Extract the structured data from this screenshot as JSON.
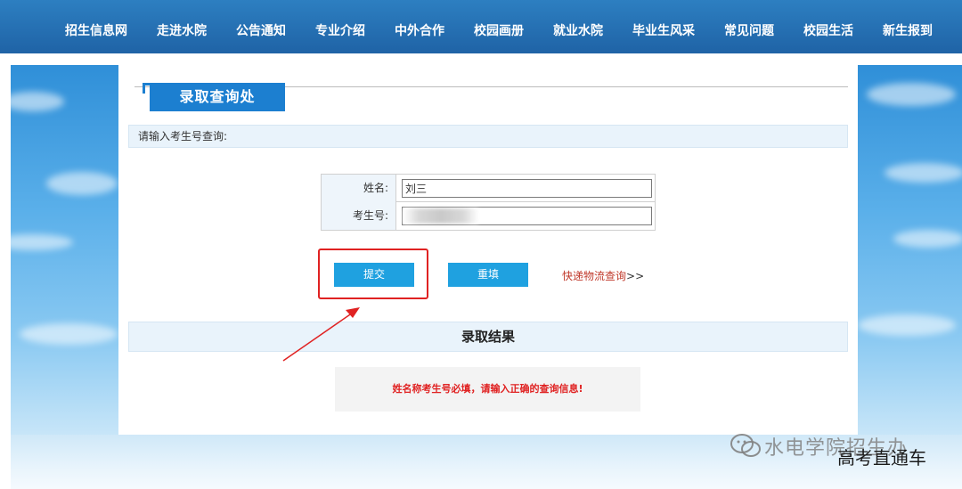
{
  "nav": {
    "items": [
      {
        "label": "招生信息网"
      },
      {
        "label": "走进水院"
      },
      {
        "label": "公告通知"
      },
      {
        "label": "专业介绍"
      },
      {
        "label": "中外合作"
      },
      {
        "label": "校园画册"
      },
      {
        "label": "就业水院"
      },
      {
        "label": "毕业生风采"
      },
      {
        "label": "常见问题"
      },
      {
        "label": "校园生活"
      },
      {
        "label": "新生报到"
      }
    ]
  },
  "section": {
    "title": "录取查询处",
    "prompt": "请输入考生号查询:"
  },
  "form": {
    "name_label": "姓名:",
    "name_value": "刘三",
    "exam_label": "考生号:",
    "exam_value": ""
  },
  "buttons": {
    "submit_label": "提交",
    "reset_label": "重填"
  },
  "express_link": {
    "label": "快递物流查询",
    "arrows": ">>"
  },
  "result": {
    "title": "录取结果",
    "message": "姓名称考生号必填，请输入正确的查询信息!"
  },
  "watermark": {
    "line1": "水电学院招生办",
    "line2": "高考直通车"
  },
  "colors": {
    "nav_bg": "#1f63a6",
    "title_tab": "#1c7fd0",
    "button_bg": "#1fa1e0",
    "highlight": "#e02222",
    "link": "#c0392b",
    "error_text": "#e02222"
  }
}
